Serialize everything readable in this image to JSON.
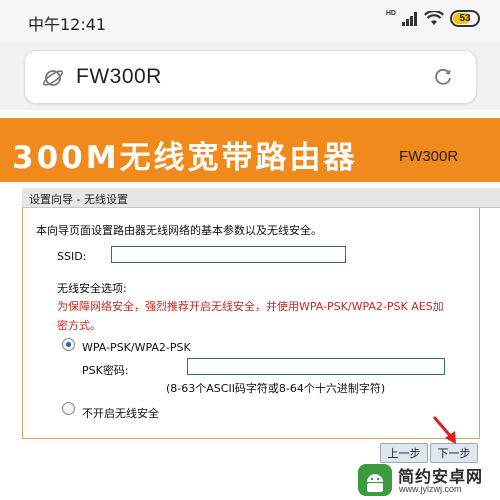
{
  "status_bar": {
    "time": "中午12:41",
    "network_label": "HD",
    "battery": "53"
  },
  "browser": {
    "url": "FW300R",
    "icons": [
      "planet-icon",
      "reload-icon"
    ]
  },
  "banner": {
    "title": "300M无线宽带路由器",
    "model": "FW300R",
    "color": "#f08a1c"
  },
  "wizard": {
    "title": "设置向导 - 无线设置",
    "intro": "本向导页面设置路由器无线网络的基本参数以及无线安全。",
    "ssid_label": "SSID:",
    "ssid_value": "",
    "security_title": "无线安全选项:",
    "warning_line1": "为保障网络安全，强烈推荐开启无线安全，并使用WPA-PSK/WPA2-PSK AES加",
    "warning_line2": "密方式。",
    "options": [
      {
        "label": "WPA-PSK/WPA2-PSK",
        "selected": true
      },
      {
        "label": "不开启无线安全",
        "selected": false
      }
    ],
    "psk_label": "PSK密码:",
    "psk_value": "",
    "psk_hint": "(8-63个ASCII码字符或8-64个十六进制字符)",
    "buttons": {
      "prev": "上一步",
      "next": "下一步"
    },
    "warning_color": "#c8281e"
  },
  "watermark": {
    "name": "简约安卓网",
    "url": "www.jylzwj.com"
  }
}
